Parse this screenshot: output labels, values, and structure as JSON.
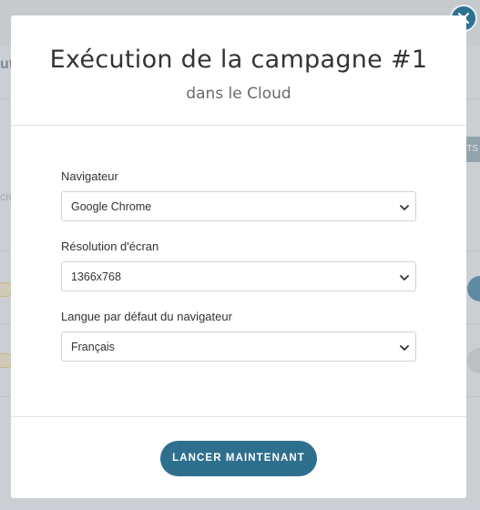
{
  "modal": {
    "title": "Exécution de la campagne #1",
    "subtitle": "dans le Cloud",
    "close_icon": "close-icon"
  },
  "form": {
    "browser": {
      "label": "Navigateur",
      "value": "Google Chrome"
    },
    "resolution": {
      "label": "Résolution d'écran",
      "value": "1366x768"
    },
    "language": {
      "label": "Langue par défaut du navigateur",
      "value": "Français"
    }
  },
  "footer": {
    "launch_label": "LANCER MAINTENANT"
  },
  "background": {
    "fragment_left": "ut",
    "fragment_tab": "TS",
    "fragment_cr": "CR"
  },
  "colors": {
    "accent": "#2f6f8e",
    "overlay": "#cbcfd3"
  }
}
